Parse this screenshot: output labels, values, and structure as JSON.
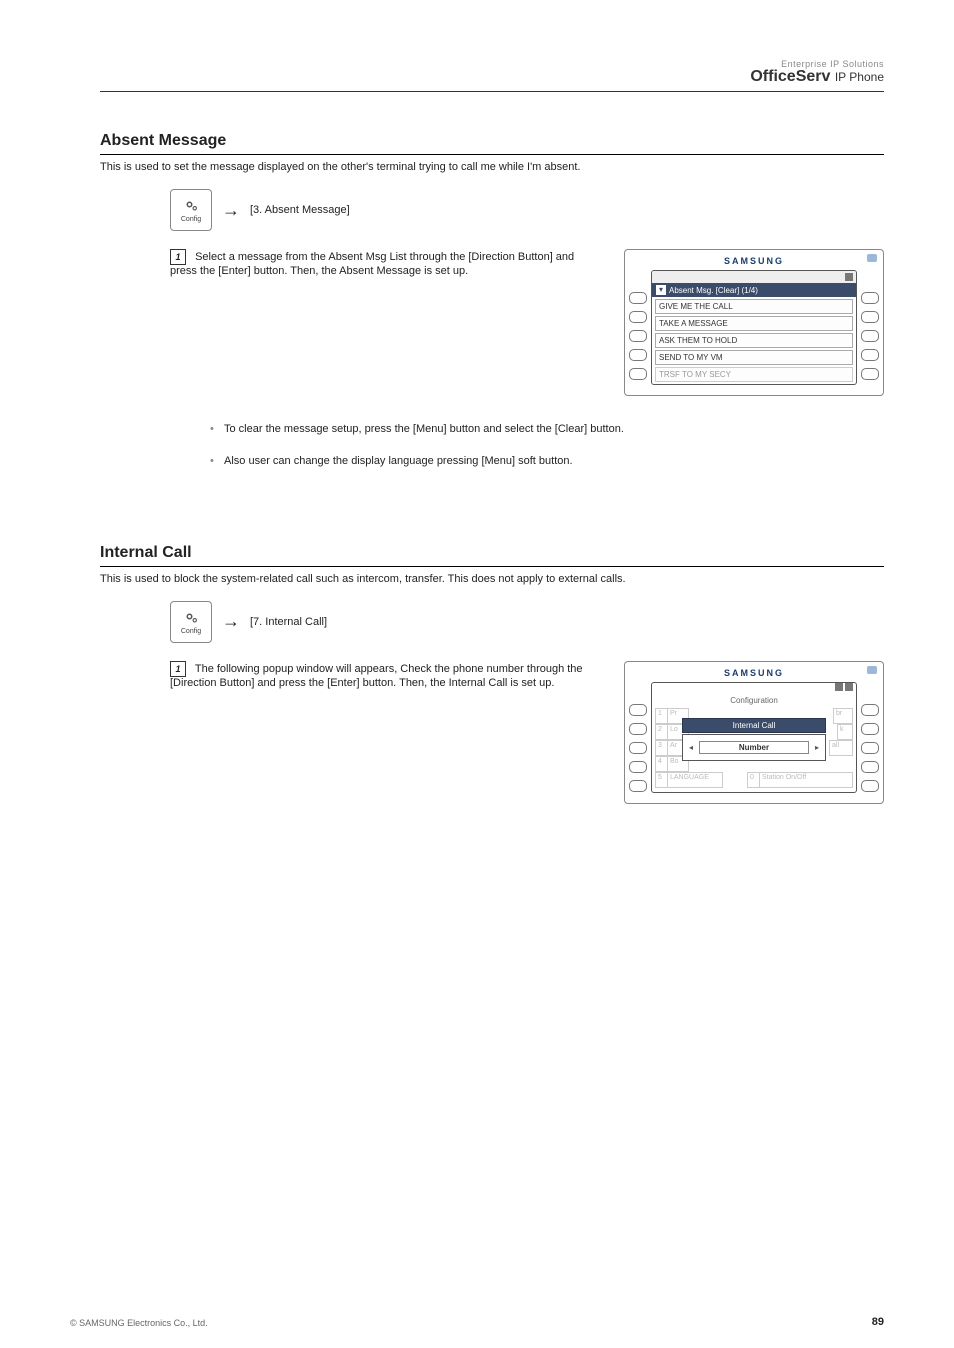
{
  "header": {
    "small": "Enterprise IP Solutions",
    "brand_bold": "Office",
    "brand_thin": "Serv",
    "tail": "IP Phone"
  },
  "section1": {
    "title": "Absent Message",
    "desc": "This is used to set the message displayed on the other's terminal trying to call me while I'm absent.",
    "icon_label": "Config",
    "icon_text": "[3. Absent Message]",
    "step1_label": "1",
    "step1_text": "Select a message from the Absent Msg List through the [Direction Button] and press the [Enter] button. Then, the Absent Message is set up.",
    "bullet1": "To clear the message setup, press the [Menu] button and select the [Clear] button.",
    "bullet2": "Also user can change the display language pressing [Menu] soft button."
  },
  "section2": {
    "title": "Internal Call",
    "desc": "This is used to block the system-related call such as intercom, transfer. This does not apply to external calls.",
    "icon_label": "Config",
    "icon_text": "[7. Internal Call]",
    "step1_label": "1",
    "step1_text": "The following popup window will appears, Check the phone number through the [Direction Button] and press the [Enter] button. Then, the Internal Call is set up."
  },
  "phone1": {
    "brand": "SAMSUNG",
    "title": "Absent Msg.  [Clear]  (1/4)",
    "items": [
      "GIVE ME THE CALL",
      "TAKE A MESSAGE",
      "ASK THEM TO HOLD",
      "SEND TO MY VM",
      "TRSF TO MY SECY"
    ]
  },
  "phone2": {
    "brand": "SAMSUNG",
    "title": "Configuration",
    "popup_header": "Internal Call",
    "popup_label": "Number",
    "bg": {
      "r1a": "1",
      "r1b": "Pr",
      "r2a": "2",
      "r2b": "Lo",
      "r3a": "3",
      "r3b": "Ar",
      "r3c": "all",
      "r4a": "4",
      "r4b": "Bo",
      "r5a": "5",
      "r5b": "LANGUAGE",
      "r5c": "0",
      "r5d": "Station On/Off",
      "r1c": "br",
      "r2c": "k"
    }
  },
  "footer": {
    "copyright": "© SAMSUNG Electronics Co., Ltd.",
    "page": "89"
  }
}
